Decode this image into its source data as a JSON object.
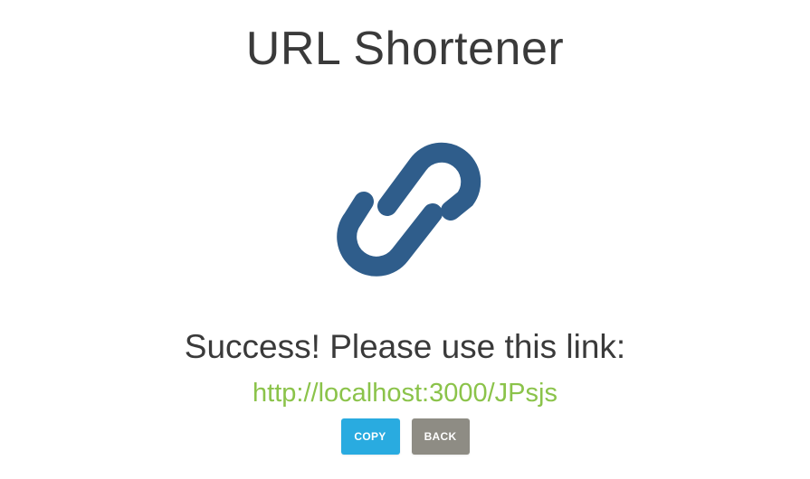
{
  "header": {
    "title": "URL Shortener"
  },
  "logo": {
    "icon": "link-icon",
    "color": "#2f5d8b"
  },
  "result": {
    "message": "Success! Please use this link:",
    "short_url": "http://localhost:3000/JPsjs",
    "link_color": "#8bc34a"
  },
  "actions": {
    "copy_label": "COPY",
    "back_label": "BACK",
    "copy_color": "#29abe0",
    "back_color": "#8e8c84"
  }
}
